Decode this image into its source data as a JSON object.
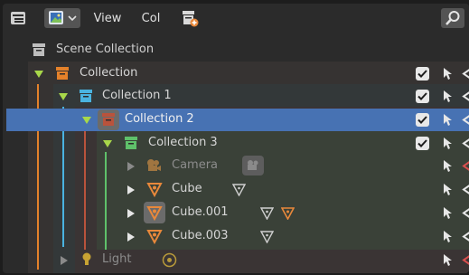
{
  "header": {
    "view_label": "View",
    "col_label": "Col"
  },
  "tree": {
    "scene_collection": "Scene Collection",
    "rows": [
      {
        "label": "Collection"
      },
      {
        "label": "Collection 1"
      },
      {
        "label": "Collection 2"
      },
      {
        "label": "Collection 3"
      },
      {
        "label": "Camera"
      },
      {
        "label": "Cube"
      },
      {
        "label": "Cube.001"
      },
      {
        "label": "Cube.003"
      },
      {
        "label": "Light"
      }
    ]
  },
  "colors": {
    "selected_row": "#4772b3",
    "collection_orange": "#e4812a",
    "collection_blue": "#4ab3e0",
    "collection_red": "#b9533c",
    "collection_green": "#5fc16a",
    "expand_green": "#a8d84a",
    "mesh_orange": "#e8883b",
    "camera_orange": "#c4843f",
    "light_yellow": "#e6c23a"
  },
  "icons": [
    "editor-type-icon",
    "display-mode-icon",
    "new-collection-icon",
    "search-icon",
    "checkbox-icon",
    "select-arrow-icon",
    "visibility-icon"
  ]
}
